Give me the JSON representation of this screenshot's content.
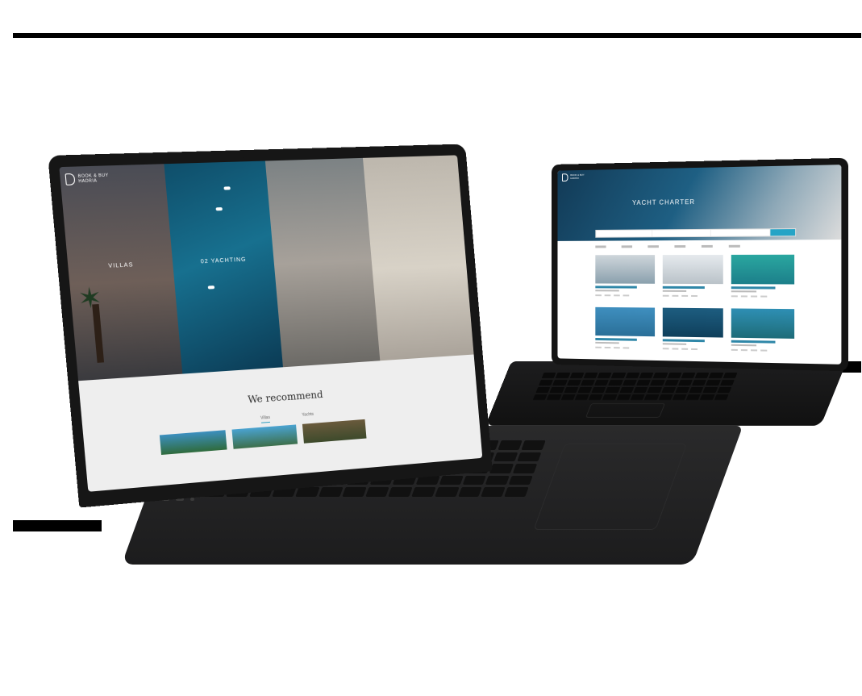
{
  "laptop": {
    "brand": {
      "line1": "BOOK & BUY",
      "line2": "HADRIA"
    },
    "panels": [
      {
        "label": "VILLAS"
      },
      {
        "label": "02 YACHTING"
      },
      {
        "label": ""
      },
      {
        "label": ""
      }
    ],
    "recommend_title": "We recommend",
    "tabs": [
      "Villas",
      "Yachts"
    ]
  },
  "tablet": {
    "brand": {
      "line1": "BOOK & BUY",
      "line2": "HADRIA"
    },
    "hero_title": "YACHT CHARTER",
    "search_button": "Search"
  }
}
